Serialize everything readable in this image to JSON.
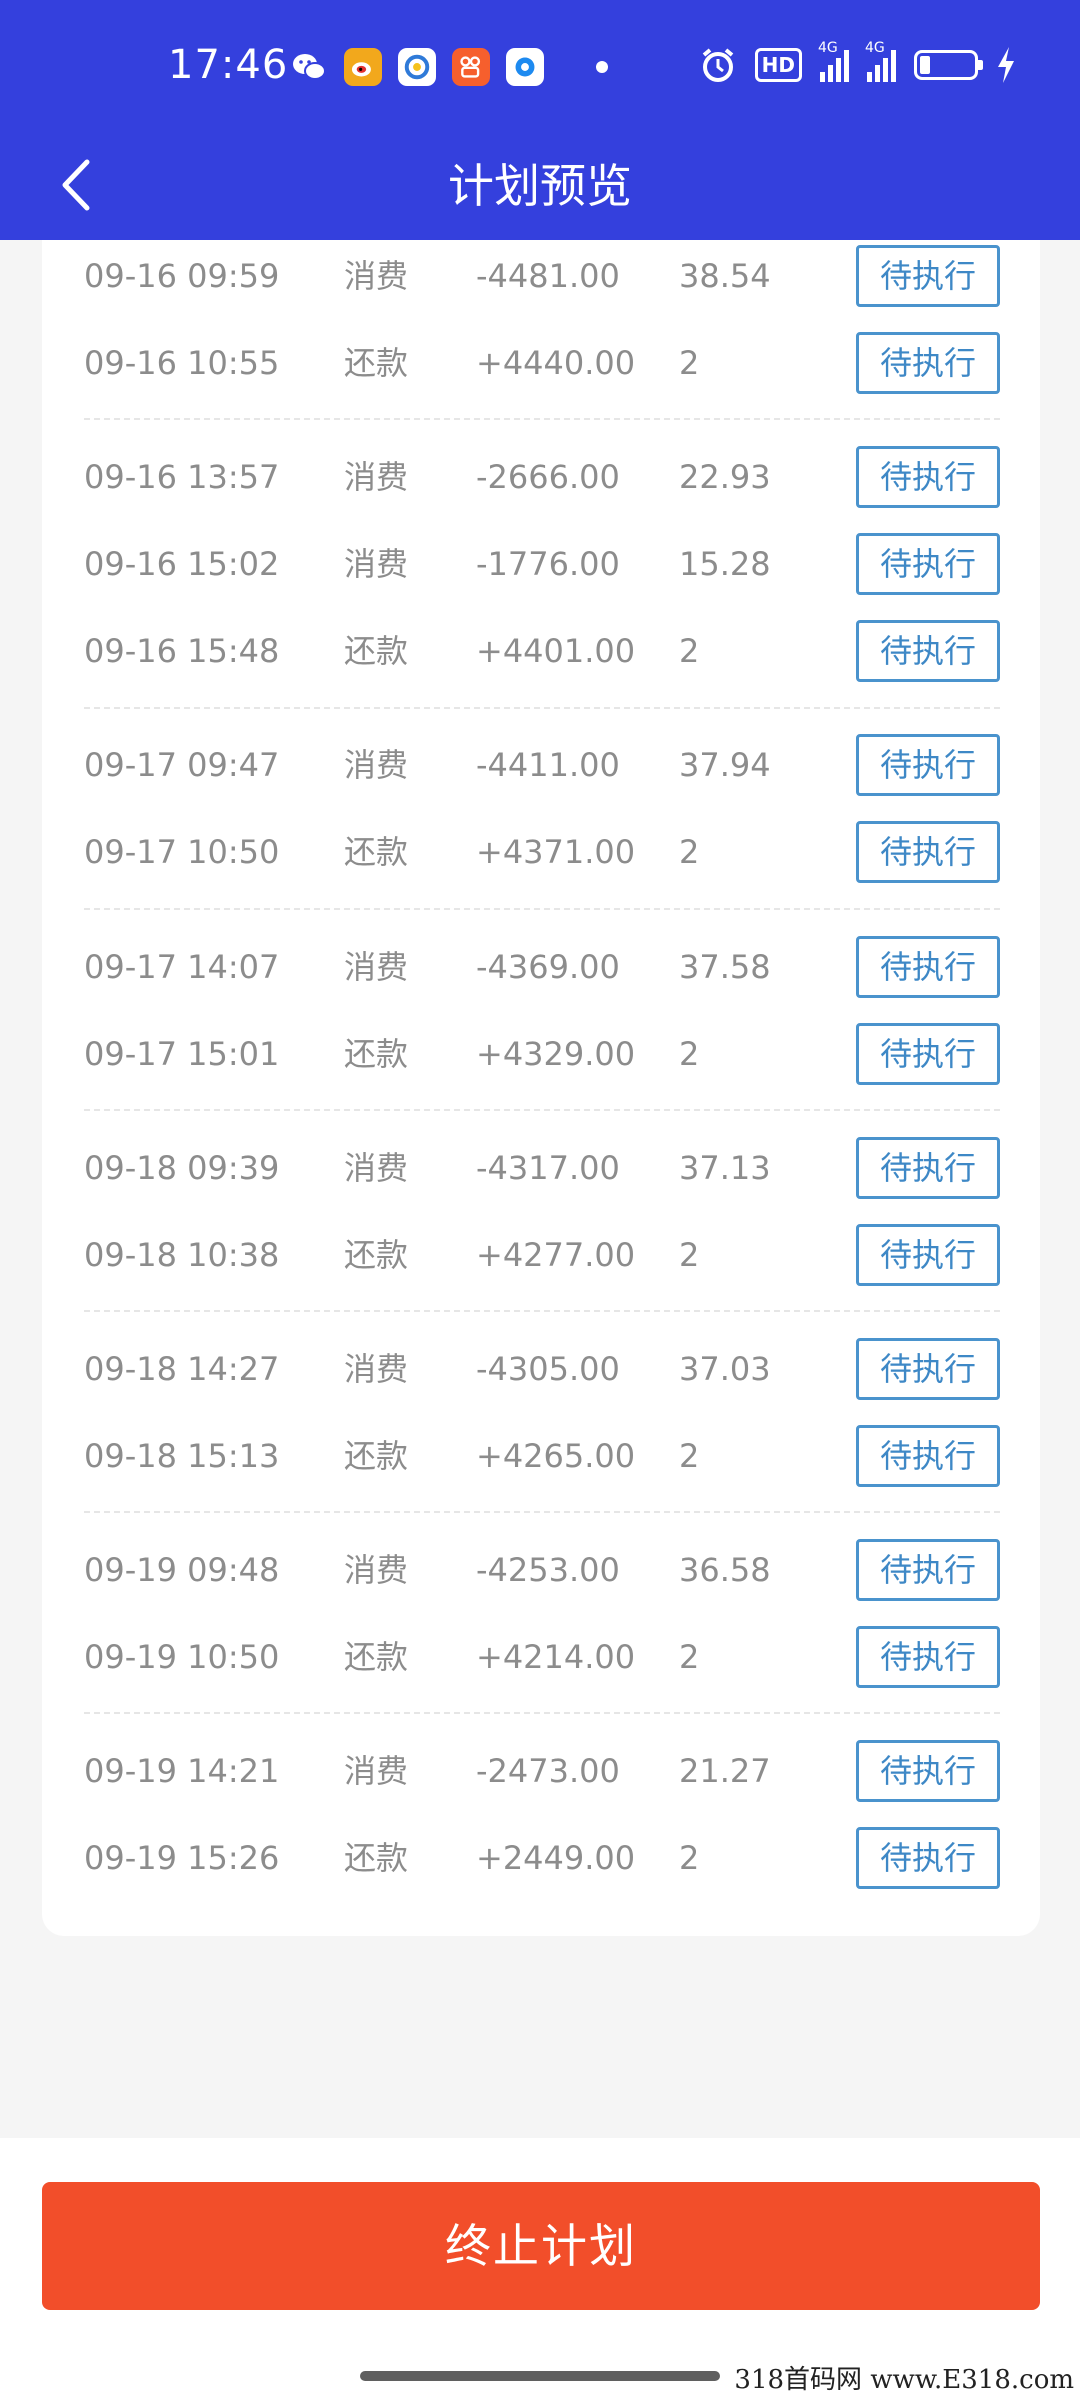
{
  "status_bar": {
    "time": "17:46",
    "notification_icons": [
      "wechat-icon",
      "weibo-icon",
      "qq-icon",
      "kuaishou-icon",
      "app-icon"
    ],
    "network": [
      "4G",
      "4G"
    ],
    "hd_label": "HD"
  },
  "header": {
    "title": "计划预览",
    "back_icon": "chevron-left-icon"
  },
  "plan": {
    "rows": [
      {
        "time": "09-16 09:59",
        "type": "消费",
        "amount": "-4481.00",
        "fee": "38.54",
        "status": "待执行"
      },
      {
        "time": "09-16 10:55",
        "type": "还款",
        "amount": "+4440.00",
        "fee": "2",
        "status": "待执行"
      },
      {
        "time": "09-16 13:57",
        "type": "消费",
        "amount": "-2666.00",
        "fee": "22.93",
        "status": "待执行"
      },
      {
        "time": "09-16 15:02",
        "type": "消费",
        "amount": "-1776.00",
        "fee": "15.28",
        "status": "待执行"
      },
      {
        "time": "09-16 15:48",
        "type": "还款",
        "amount": "+4401.00",
        "fee": "2",
        "status": "待执行"
      },
      {
        "time": "09-17 09:47",
        "type": "消费",
        "amount": "-4411.00",
        "fee": "37.94",
        "status": "待执行"
      },
      {
        "time": "09-17 10:50",
        "type": "还款",
        "amount": "+4371.00",
        "fee": "2",
        "status": "待执行"
      },
      {
        "time": "09-17 14:07",
        "type": "消费",
        "amount": "-4369.00",
        "fee": "37.58",
        "status": "待执行"
      },
      {
        "time": "09-17 15:01",
        "type": "还款",
        "amount": "+4329.00",
        "fee": "2",
        "status": "待执行"
      },
      {
        "time": "09-18 09:39",
        "type": "消费",
        "amount": "-4317.00",
        "fee": "37.13",
        "status": "待执行"
      },
      {
        "time": "09-18 10:38",
        "type": "还款",
        "amount": "+4277.00",
        "fee": "2",
        "status": "待执行"
      },
      {
        "time": "09-18 14:27",
        "type": "消费",
        "amount": "-4305.00",
        "fee": "37.03",
        "status": "待执行"
      },
      {
        "time": "09-18 15:13",
        "type": "还款",
        "amount": "+4265.00",
        "fee": "2",
        "status": "待执行"
      },
      {
        "time": "09-19 09:48",
        "type": "消费",
        "amount": "-4253.00",
        "fee": "36.58",
        "status": "待执行"
      },
      {
        "time": "09-19 10:50",
        "type": "还款",
        "amount": "+4214.00",
        "fee": "2",
        "status": "待执行"
      },
      {
        "time": "09-19 14:21",
        "type": "消费",
        "amount": "-2473.00",
        "fee": "21.27",
        "status": "待执行"
      },
      {
        "time": "09-19 15:26",
        "type": "还款",
        "amount": "+2449.00",
        "fee": "2",
        "status": "待执行"
      }
    ]
  },
  "footer": {
    "terminate_label": "终止计划"
  },
  "watermark": "318首码网 www.E318.com",
  "colors": {
    "header_bg": "#3440dd",
    "status_btn_border": "#4a93cd",
    "terminate_bg": "#f24e2a"
  }
}
